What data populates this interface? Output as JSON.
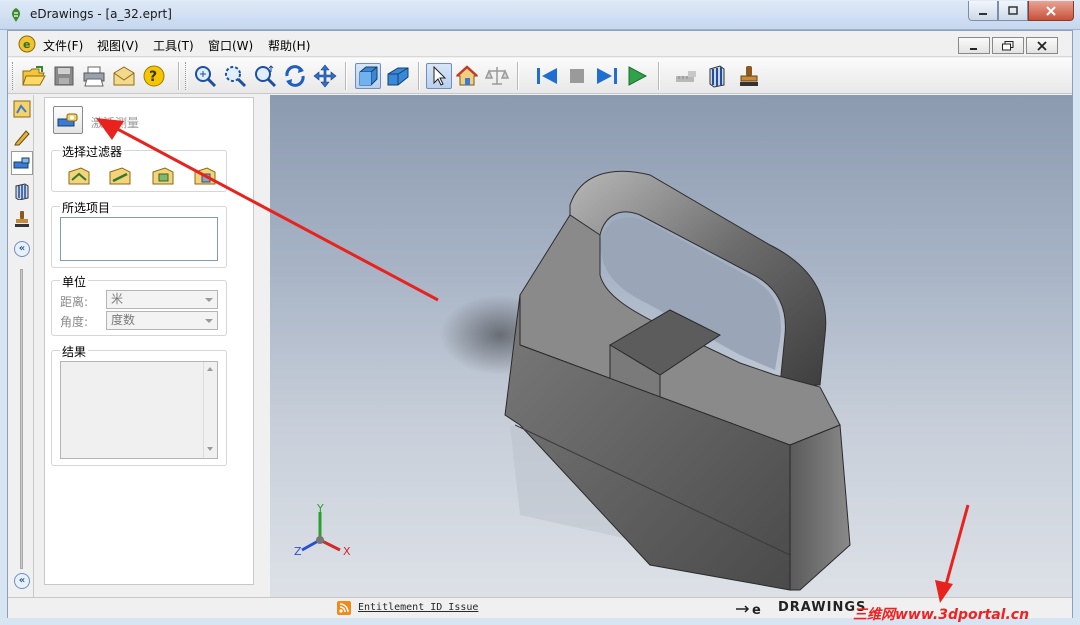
{
  "window": {
    "title": "eDrawings - [a_32.eprt]"
  },
  "menu": {
    "items": [
      "文件(F)",
      "视图(V)",
      "工具(T)",
      "窗口(W)",
      "帮助(H)"
    ]
  },
  "toolbar": {
    "buttons": [
      "open-icon",
      "save-icon",
      "print-icon",
      "email-icon",
      "help-icon",
      "zoom-fit-icon",
      "zoom-area-icon",
      "zoom-in-out-icon",
      "rotate-icon",
      "pan-icon",
      "shaded-icon",
      "perspective-icon",
      "select-icon",
      "home-icon",
      "measure-balance-icon",
      "first-frame-icon",
      "stop-icon",
      "next-frame-icon",
      "play-icon",
      "measure-disabled-icon",
      "section-icon",
      "stamp-icon"
    ]
  },
  "measure_panel": {
    "activate_label": "激活测量",
    "filter_title": "选择过滤器",
    "selected_title": "所选项目",
    "units_title": "单位",
    "distance_label": "距离:",
    "distance_value": "米",
    "angle_label": "角度:",
    "angle_value": "度数",
    "results_title": "结果"
  },
  "status": {
    "link": "Entitlement ID Issue",
    "brand": "DRAWINGS",
    "watermark": "三维网www.3dportal.cn"
  },
  "triad": {
    "x": "X",
    "y": "Y",
    "z": "Z"
  }
}
